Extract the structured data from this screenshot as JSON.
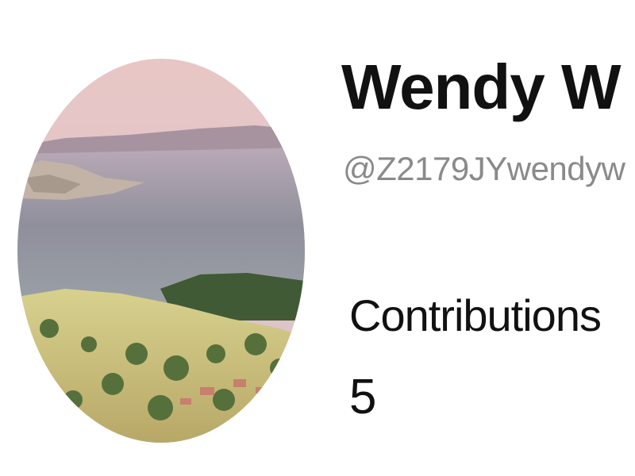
{
  "profile": {
    "display_name": "Wendy W",
    "handle": "@Z2179JYwendyw",
    "avatar_icon": "landscape-photo-avatar",
    "stats": {
      "contributions_label": "Contributions",
      "contributions_value": "5"
    }
  }
}
